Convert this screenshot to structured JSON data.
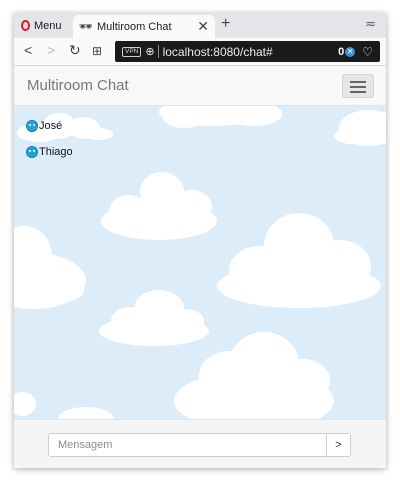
{
  "browser": {
    "menu_label": "Menu",
    "tab_title": "Multiroom Chat",
    "tab_icon": "incognito-icon",
    "url": "localhost:8080/chat#",
    "vpn_label": "VPN",
    "adblock_count": "0"
  },
  "app": {
    "brand": "Multiroom Chat",
    "users": [
      {
        "name": "José",
        "icon": "user-face-icon"
      },
      {
        "name": "Thiago",
        "icon": "user-face-icon"
      }
    ],
    "message_placeholder": "Mensagem",
    "send_label": ">"
  },
  "colors": {
    "sky": "#dcedf9",
    "user_icon": "#22a5d6",
    "opera_red": "#e0162b"
  }
}
